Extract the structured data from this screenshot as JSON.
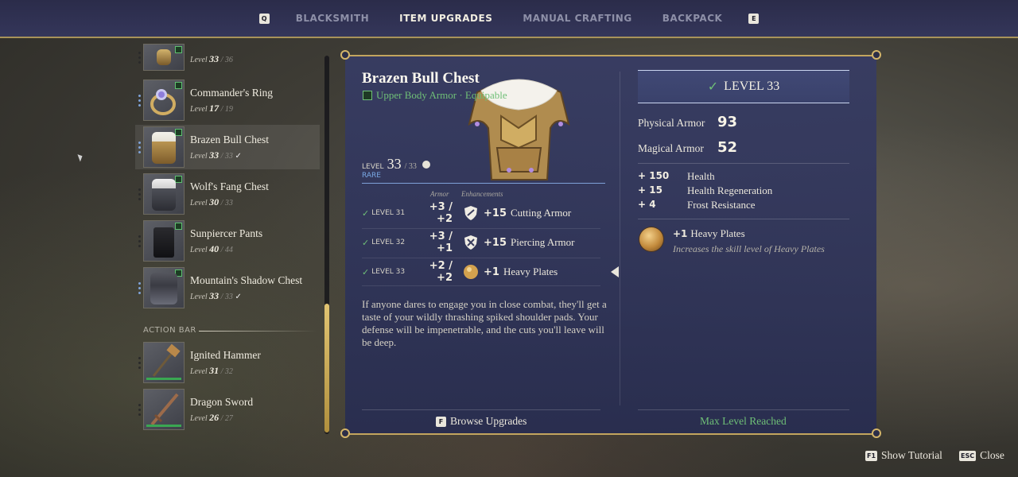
{
  "nav": {
    "left_key": "Q",
    "right_key": "E",
    "tabs": [
      {
        "label": "BLACKSMITH",
        "active": false
      },
      {
        "label": "ITEM UPGRADES",
        "active": true
      },
      {
        "label": "MANUAL CRAFTING",
        "active": false
      },
      {
        "label": "BACKPACK",
        "active": false
      }
    ]
  },
  "inventory": {
    "items": [
      {
        "name": "",
        "level_prefix": "Level",
        "level": "33",
        "max": "/ 36",
        "check": ""
      },
      {
        "name": "Commander's Ring",
        "level_prefix": "Level",
        "level": "17",
        "max": "/ 19",
        "check": ""
      },
      {
        "name": "Brazen Bull Chest",
        "level_prefix": "Level",
        "level": "33",
        "max": "/ 33",
        "check": "✓"
      },
      {
        "name": "Wolf's Fang Chest",
        "level_prefix": "Level",
        "level": "30",
        "max": "/ 33",
        "check": ""
      },
      {
        "name": "Sunpiercer Pants",
        "level_prefix": "Level",
        "level": "40",
        "max": "/ 44",
        "check": ""
      },
      {
        "name": "Mountain's Shadow Chest",
        "level_prefix": "Level",
        "level": "33",
        "max": "/ 33",
        "check": "✓"
      }
    ],
    "action_bar_label": "ACTION BAR",
    "action_items": [
      {
        "name": "Ignited Hammer",
        "level_prefix": "Level",
        "level": "31",
        "max": "/ 32"
      },
      {
        "name": "Dragon Sword",
        "level_prefix": "Level",
        "level": "26",
        "max": "/ 27"
      }
    ]
  },
  "detail": {
    "title": "Brazen Bull Chest",
    "type": "Upper Body Armor · Equipable",
    "level_label": "LEVEL",
    "level": "33",
    "level_max": "/ 33",
    "rarity": "RARE",
    "col_armor": "Armor",
    "col_enh": "Enhancements",
    "upgrades": [
      {
        "level": "LEVEL 31",
        "armor": "+3 / +2",
        "value": "+15",
        "name": "Cutting Armor",
        "icon": "shield-slash-icon"
      },
      {
        "level": "LEVEL 32",
        "armor": "+3 / +1",
        "value": "+15",
        "name": "Piercing Armor",
        "icon": "shield-cross-icon"
      },
      {
        "level": "LEVEL 33",
        "armor": "+2 / +2",
        "value": "+1",
        "name": "Heavy Plates",
        "icon": "gold-orb-icon"
      }
    ],
    "description": "If anyone dares to engage you in close combat, they'll get a taste of your wildly thrashing spiked shoulder pads. Your defense will be impenetrable, and the cuts you'll leave will be deep.",
    "browse_key": "F",
    "browse_label": "Browse Upgrades",
    "max_label": "Max Level Reached"
  },
  "summary": {
    "level_banner": "LEVEL 33",
    "physical_label": "Physical Armor",
    "physical_value": "93",
    "magical_label": "Magical Armor",
    "magical_value": "52",
    "bonuses": [
      {
        "value": "+ 150",
        "name": "Health"
      },
      {
        "value": "+ 15",
        "name": "Health Regeneration"
      },
      {
        "value": "+ 4",
        "name": "Frost Resistance"
      }
    ],
    "perk_value": "+1",
    "perk_name": "Heavy Plates",
    "perk_desc": "Increases the skill level of Heavy Plates"
  },
  "footer": {
    "tutorial_key": "F1",
    "tutorial_label": "Show Tutorial",
    "close_key": "ESC",
    "close_label": "Close"
  },
  "colors": {
    "accent_gold": "#c3a55e",
    "ok_green": "#6fbf77",
    "rare_blue": "#79a8e4"
  }
}
